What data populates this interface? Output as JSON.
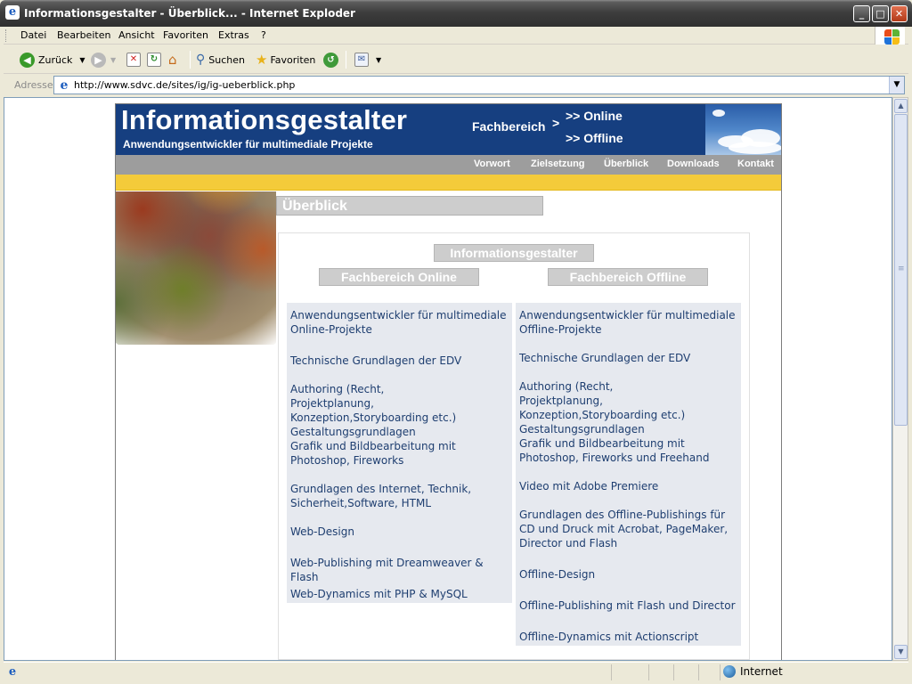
{
  "window": {
    "title": "Informationsgestalter - Überblick... - Internet Exploder",
    "minimize": "_",
    "maximize": "□",
    "close": "✕"
  },
  "menu": [
    "Datei",
    "Bearbeiten",
    "Ansicht",
    "Favoriten",
    "Extras",
    "?"
  ],
  "toolbar": {
    "back_label": "Zurück",
    "search_label": "Suchen",
    "favorites_label": "Favoriten"
  },
  "address": {
    "label": "Adresse",
    "url": "http://www.sdvc.de/sites/ig/ig-ueberblick.php"
  },
  "site": {
    "title": "Informationsgestalter",
    "subtitle": "Anwendungsentwickler für multimediale Projekte",
    "fachbereich_label": "Fachbereich",
    "fachbereich_arrow": ">",
    "link_online": ">> Online",
    "link_offline": ">> Offline",
    "nav": [
      "Vorwort",
      "Zielsetzung",
      "Überblick",
      "Downloads",
      "Kontakt"
    ],
    "page_heading": "Überblick",
    "btn_main": "Informationsgestalter",
    "btn_online": "Fachbereich Online",
    "btn_offline": "Fachbereich Offline",
    "online_items": [
      "Anwendungsentwickler für multimediale Online-Projekte",
      "Technische Grundlagen der EDV",
      "Authoring (Recht, Projektplanung, Konzeption,Storyboarding etc.) Gestaltungsgrundlagen",
      "Grafik und Bildbearbeitung mit Photoshop, Fireworks",
      "Grundlagen des Internet, Technik, Sicherheit,Software, HTML",
      "Web-Design",
      "Web-Publishing mit Dreamweaver & Flash",
      "Web-Dynamics mit PHP & MySQL"
    ],
    "offline_items": [
      "Anwendungsentwickler für multimediale Offline-Projekte",
      "Technische Grundlagen der EDV",
      "Authoring (Recht, Projektplanung, Konzeption,Storyboarding etc.) Gestaltungsgrundlagen",
      "Grafik und Bildbearbeitung mit Photoshop, Fireworks und Freehand",
      "Video mit Adobe Premiere",
      "Grundlagen des Offline-Publishings für CD und Druck mit Acrobat, PageMaker, Director und Flash",
      "Offline-Design",
      "Offline-Publishing mit Flash und Director",
      "Offline-Dynamics mit Actionscript"
    ]
  },
  "status": {
    "zone": "Internet"
  },
  "colors": {
    "banner": "#163f80",
    "nav_bar": "#9d9d9d",
    "accent_yellow": "#f4cb3a",
    "link": "#1e3e70",
    "column_bg": "#e6e9ef"
  }
}
